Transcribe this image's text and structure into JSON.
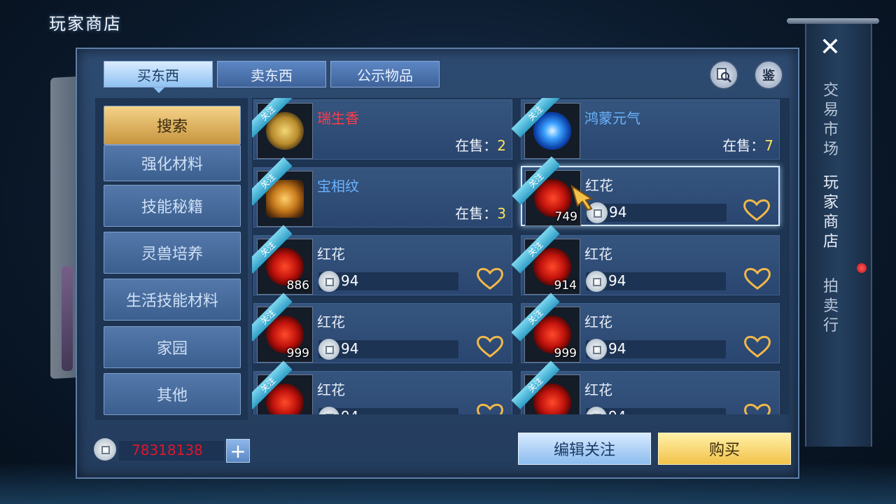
{
  "window_title": "玩家商店",
  "tabs": [
    {
      "label": "买东西",
      "active": true
    },
    {
      "label": "卖东西",
      "active": false
    },
    {
      "label": "公示物品",
      "active": false
    }
  ],
  "top_icons": {
    "search_icon": "magnifier-scroll-icon",
    "appraise_label": "鉴"
  },
  "categories": [
    {
      "label": "搜索",
      "active": true
    },
    {
      "label": "强化材料"
    },
    {
      "label": "技能秘籍"
    },
    {
      "label": "灵兽培养"
    },
    {
      "label": "生活技能材料"
    },
    {
      "label": "家园"
    },
    {
      "label": "其他"
    }
  ],
  "follow_tag": "关注",
  "onsale_label": "在售：",
  "items": [
    {
      "name": "瑞生香",
      "name_color": "#ff3b4a",
      "art": "gold",
      "onsale": "2"
    },
    {
      "name": "鸿蒙元气",
      "name_color": "#6ab4ff",
      "art": "blue",
      "onsale": "7"
    },
    {
      "name": "宝相纹",
      "name_color": "#6ab4ff",
      "art": "bronze",
      "onsale": "3"
    },
    {
      "name": "红花",
      "name_color": "#ffffff",
      "art": "red",
      "count": "749",
      "price": "94",
      "selected": true
    },
    {
      "name": "红花",
      "name_color": "#ffffff",
      "art": "red",
      "count": "886",
      "price": "94"
    },
    {
      "name": "红花",
      "name_color": "#ffffff",
      "art": "red",
      "count": "914",
      "price": "94"
    },
    {
      "name": "红花",
      "name_color": "#ffffff",
      "art": "red",
      "count": "999",
      "price": "94"
    },
    {
      "name": "红花",
      "name_color": "#ffffff",
      "art": "red",
      "count": "999",
      "price": "94"
    },
    {
      "name": "红花",
      "name_color": "#ffffff",
      "art": "red",
      "count": "",
      "price": "94"
    },
    {
      "name": "红花",
      "name_color": "#ffffff",
      "art": "red",
      "count": "",
      "price": "94"
    }
  ],
  "currency": {
    "amount": "78318138",
    "add_label": "+"
  },
  "buttons": {
    "edit_follow": "编辑关注",
    "buy": "购买"
  },
  "right_nav": {
    "close_label": "✕",
    "items": [
      {
        "label": "交易市场",
        "active": false
      },
      {
        "label": "玩家商店",
        "active": true
      },
      {
        "label": "拍卖行",
        "active": false
      }
    ]
  },
  "colors": {
    "accent_gold": "#f2c24a",
    "price_red": "#e0162b",
    "onsale_yellow": "#ffe25a"
  }
}
